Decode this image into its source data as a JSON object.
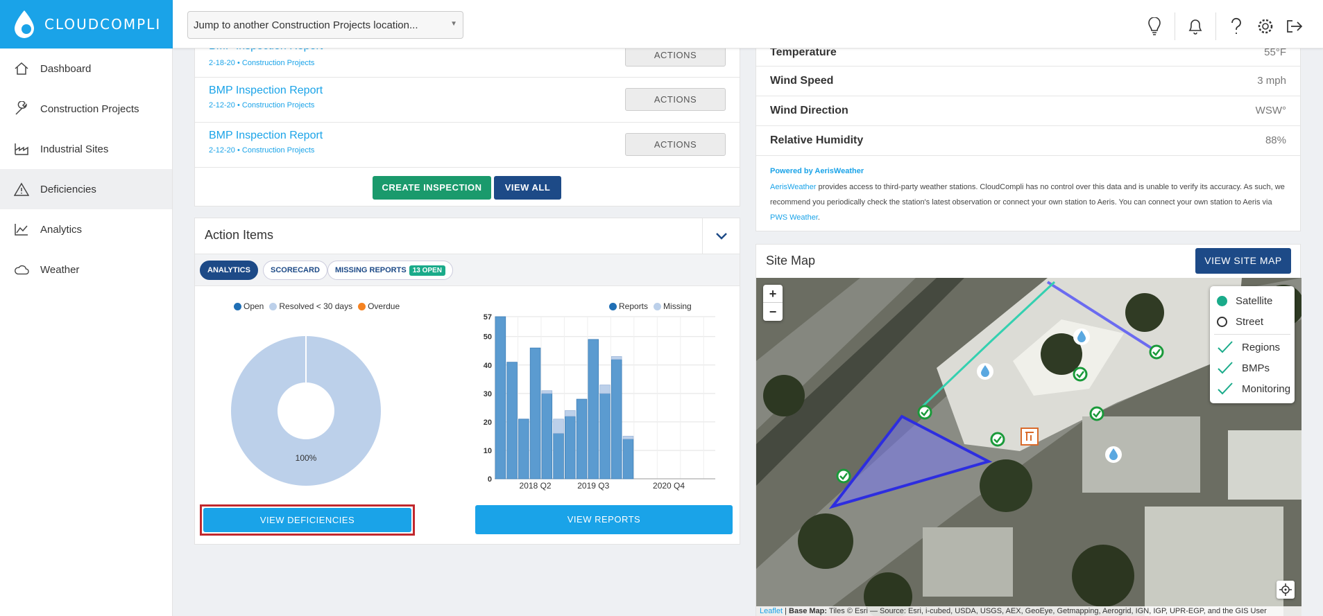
{
  "app": {
    "logo_text": "CLOUDCOMPLI"
  },
  "sidebar": {
    "items": [
      {
        "label": "Dashboard",
        "icon": "home-icon"
      },
      {
        "label": "Construction Projects",
        "icon": "wrench-icon"
      },
      {
        "label": "Industrial Sites",
        "icon": "factory-icon"
      },
      {
        "label": "Deficiencies",
        "icon": "warning-icon"
      },
      {
        "label": "Analytics",
        "icon": "analytics-icon"
      },
      {
        "label": "Weather",
        "icon": "cloud-icon"
      }
    ],
    "active_index": 3
  },
  "header": {
    "jump_placeholder": "Jump to another Construction Projects location...",
    "icons": [
      "lightbulb-icon",
      "bell-icon",
      "help-icon",
      "gear-icon",
      "logout-icon"
    ]
  },
  "inspections": {
    "rows": [
      {
        "title": "BMP Inspection Report",
        "sub": "2-18-20 • Construction Projects",
        "action": "ACTIONS"
      },
      {
        "title": "BMP Inspection Report",
        "sub": "2-12-20 • Construction Projects",
        "action": "ACTIONS"
      },
      {
        "title": "BMP Inspection Report",
        "sub": "2-12-20 • Construction Projects",
        "action": "ACTIONS"
      }
    ],
    "create_label": "CREATE INSPECTION",
    "view_all_label": "VIEW ALL"
  },
  "action_items": {
    "title": "Action Items",
    "tabs": {
      "analytics": "ANALYTICS",
      "scorecard": "SCORECARD",
      "missing": "MISSING REPORTS",
      "missing_badge": "13 OPEN"
    },
    "pie_legend": {
      "open": "Open",
      "resolved": "Resolved < 30 days",
      "overdue": "Overdue"
    },
    "bar_legend": {
      "reports": "Reports",
      "missing": "Missing"
    },
    "view_deficiencies": "VIEW DEFICIENCIES",
    "view_reports": "VIEW REPORTS"
  },
  "chart_data": [
    {
      "type": "pie",
      "labels": [
        "Open",
        "Resolved < 30 days",
        "Overdue"
      ],
      "values": [
        0,
        100,
        0
      ],
      "data_label": "100%",
      "colors": [
        "#1f6fb5",
        "#bcd0ea",
        "#f58220"
      ]
    },
    {
      "type": "bar",
      "x_tick_labels": [
        "2018 Q2",
        "2019 Q3",
        "2020 Q4"
      ],
      "y_ticks": [
        0,
        10,
        20,
        30,
        40,
        50,
        57
      ],
      "ylim": [
        0,
        57
      ],
      "series": [
        {
          "name": "Reports",
          "color": "#5b9bd0",
          "values": [
            57,
            41,
            21,
            46,
            30,
            16,
            22,
            28,
            49,
            30,
            42,
            14,
            0,
            0,
            0,
            0,
            0,
            0,
            0
          ]
        },
        {
          "name": "Missing",
          "color": "#bcd0ea",
          "values": [
            0,
            0,
            0,
            0,
            1,
            5,
            2,
            0,
            0,
            3,
            1,
            1,
            0,
            0,
            0,
            0,
            0,
            0,
            0
          ]
        }
      ]
    }
  ],
  "weather": {
    "rows": [
      {
        "label": "Temperature",
        "value": "55°F"
      },
      {
        "label": "Wind Speed",
        "value": "3 mph"
      },
      {
        "label": "Wind Direction",
        "value": "WSW°"
      },
      {
        "label": "Relative Humidity",
        "value": "88%"
      }
    ],
    "powered_by": "Powered by AerisWeather",
    "disclaimer_link": "AerisWeather",
    "disclaimer_text": " provides access to third-party weather stations. CloudCompli has no control over this data and is unable to verify its accuracy. As such, we recommend you periodically check the station's latest observation or connect your own station to Aeris. You can connect your own station to Aeris via ",
    "pws_link": "PWS Weather",
    "period": "."
  },
  "site_map": {
    "title": "Site Map",
    "button": "VIEW SITE MAP",
    "layers": [
      "Satellite",
      "Street"
    ],
    "overlays": [
      "Regions",
      "BMPs",
      "Monitoring"
    ],
    "zoom_in": "+",
    "zoom_out": "−",
    "attribution_leaflet": "Leaflet",
    "attribution_base": "Base Map:",
    "attribution_text": " Tiles © Esri — Source: Esri, i-cubed, USDA, USGS, AEX, GeoEye, Getmapping, Aerogrid, IGN, IGP, UPR-EGP, and the GIS User"
  },
  "colors": {
    "brand_blue": "#1aa3e8",
    "navy": "#1d4a87",
    "green": "#1a9a6c",
    "highlight_red": "#c0282d"
  }
}
